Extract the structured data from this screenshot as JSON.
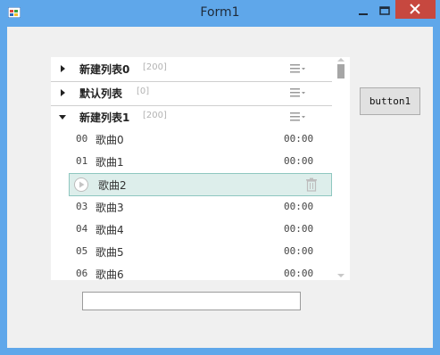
{
  "window": {
    "title": "Form1"
  },
  "groups": [
    {
      "name": "新建列表0",
      "count": "[200]",
      "expanded": false
    },
    {
      "name": "默认列表",
      "count": "[0]",
      "expanded": false
    },
    {
      "name": "新建列表1",
      "count": "[200]",
      "expanded": true
    }
  ],
  "songs": [
    {
      "index": "00",
      "name": "歌曲0",
      "duration": "00:00"
    },
    {
      "index": "01",
      "name": "歌曲1",
      "duration": "00:00"
    },
    {
      "index": "",
      "name": "歌曲2",
      "duration": "",
      "selected": true
    },
    {
      "index": "03",
      "name": "歌曲3",
      "duration": "00:00"
    },
    {
      "index": "04",
      "name": "歌曲4",
      "duration": "00:00"
    },
    {
      "index": "05",
      "name": "歌曲5",
      "duration": "00:00"
    },
    {
      "index": "06",
      "name": "歌曲6",
      "duration": "00:00"
    }
  ],
  "button1": {
    "label": "button1"
  },
  "textbox": {
    "value": ""
  },
  "icons": {
    "app": "app-icon",
    "minimize": "minimize-icon",
    "maximize": "maximize-icon",
    "close": "close-icon",
    "expand": "triangle-right-icon",
    "collapse": "triangle-down-icon",
    "menu": "list-menu-icon",
    "play": "play-icon",
    "delete": "trash-icon"
  },
  "colors": {
    "titlebar": "#5fa7ea",
    "close": "#c7483f",
    "selected_row": "#ddeeeb",
    "selected_border": "#8fc7c0"
  }
}
